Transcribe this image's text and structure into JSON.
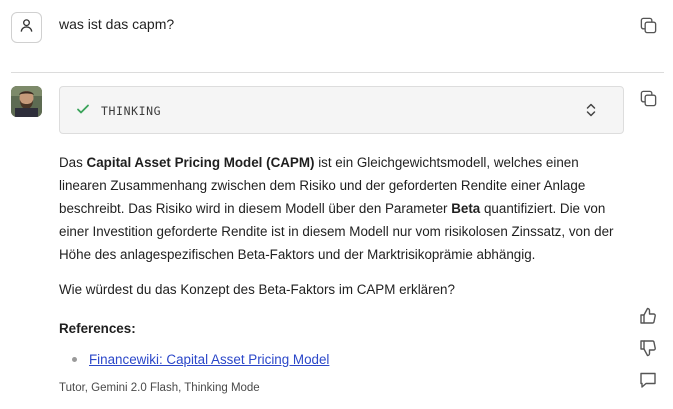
{
  "user_message": {
    "text": "was ist das capm?"
  },
  "thinking": {
    "label": "THINKING",
    "status": "done"
  },
  "answer": {
    "p1_a": "Das ",
    "p1_bold1": "Capital Asset Pricing Model (CAPM)",
    "p1_b": " ist ein Gleichgewichtsmodell, welches einen linearen Zusammenhang zwischen dem Risiko und der geforderten Rendite einer Anlage beschreibt. Das Risiko wird in diesem Modell über den Parameter ",
    "p1_bold2": "Beta",
    "p1_c": " quantifiziert. Die von einer Investition geforderte Rendite ist in diesem Modell nur vom risikolosen Zinssatz, von der Höhe des anlagespezifischen Beta-Faktors und der Marktrisikoprämie abhängig.",
    "question": "Wie würdest du das Konzept des Beta-Faktors im CAPM erklären?",
    "references_heading": "References:",
    "references": [
      {
        "label": "Financewiki: Capital Asset Pricing Model"
      }
    ]
  },
  "meta": {
    "text": "Tutor, Gemini 2.0 Flash, Thinking Mode"
  },
  "icons": {
    "user": "user-icon",
    "copy": "copy-icon",
    "check": "check-icon",
    "expand": "chevron-up-down-icon",
    "thumbs_up": "thumbs-up-icon",
    "thumbs_down": "thumbs-down-icon",
    "comment": "comment-icon"
  },
  "colors": {
    "link": "#2b47c9",
    "check": "#3aa35a",
    "thinking_bg": "#f5f5f5"
  }
}
